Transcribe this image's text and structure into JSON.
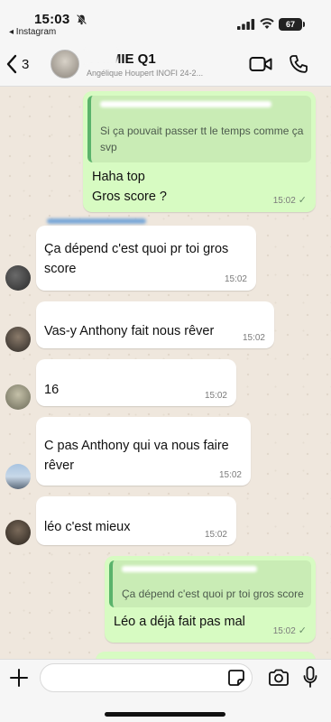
{
  "status_bar": {
    "time": "15:03",
    "back_app": "◂ Instagram",
    "battery": "67"
  },
  "header": {
    "back_count": "3",
    "group_name": "CHIMIE Q1",
    "group_sub": "Angélique Houpert INOFI 24-2..."
  },
  "messages": [
    {
      "direction": "out",
      "quote_text": "Si ça pouvait passer tt le temps comme ça svp",
      "text_lines": [
        "Haha top",
        "Gros score ?"
      ],
      "time": "15:02",
      "status": "✓"
    },
    {
      "direction": "in",
      "text_lines": [
        "Ça dépend c'est quoi pr toi gros",
        "score"
      ],
      "time": "15:02"
    },
    {
      "direction": "in",
      "text_lines": [
        "Vas-y Anthony fait nous rêver"
      ],
      "time": "15:02"
    },
    {
      "direction": "in",
      "text_lines": [
        "16"
      ],
      "time": "15:02"
    },
    {
      "direction": "in",
      "text_lines": [
        "C pas Anthony qui va nous faire",
        "rêver"
      ],
      "time": "15:02"
    },
    {
      "direction": "in",
      "text_lines": [
        "léo c'est mieux"
      ],
      "time": "15:02"
    },
    {
      "direction": "out",
      "quote_text": "Ça dépend c'est quoi pr toi gros score",
      "text_lines": [
        "Léo a déjà fait pas mal"
      ],
      "time": "15:02",
      "status": "✓"
    }
  ],
  "composer": {
    "placeholder": ""
  },
  "colors": {
    "outgoing_bubble": "#d7fbc2",
    "incoming_bubble": "#ffffff",
    "chat_background": "#efe7dd",
    "quote_bar": "#5ab36b"
  }
}
